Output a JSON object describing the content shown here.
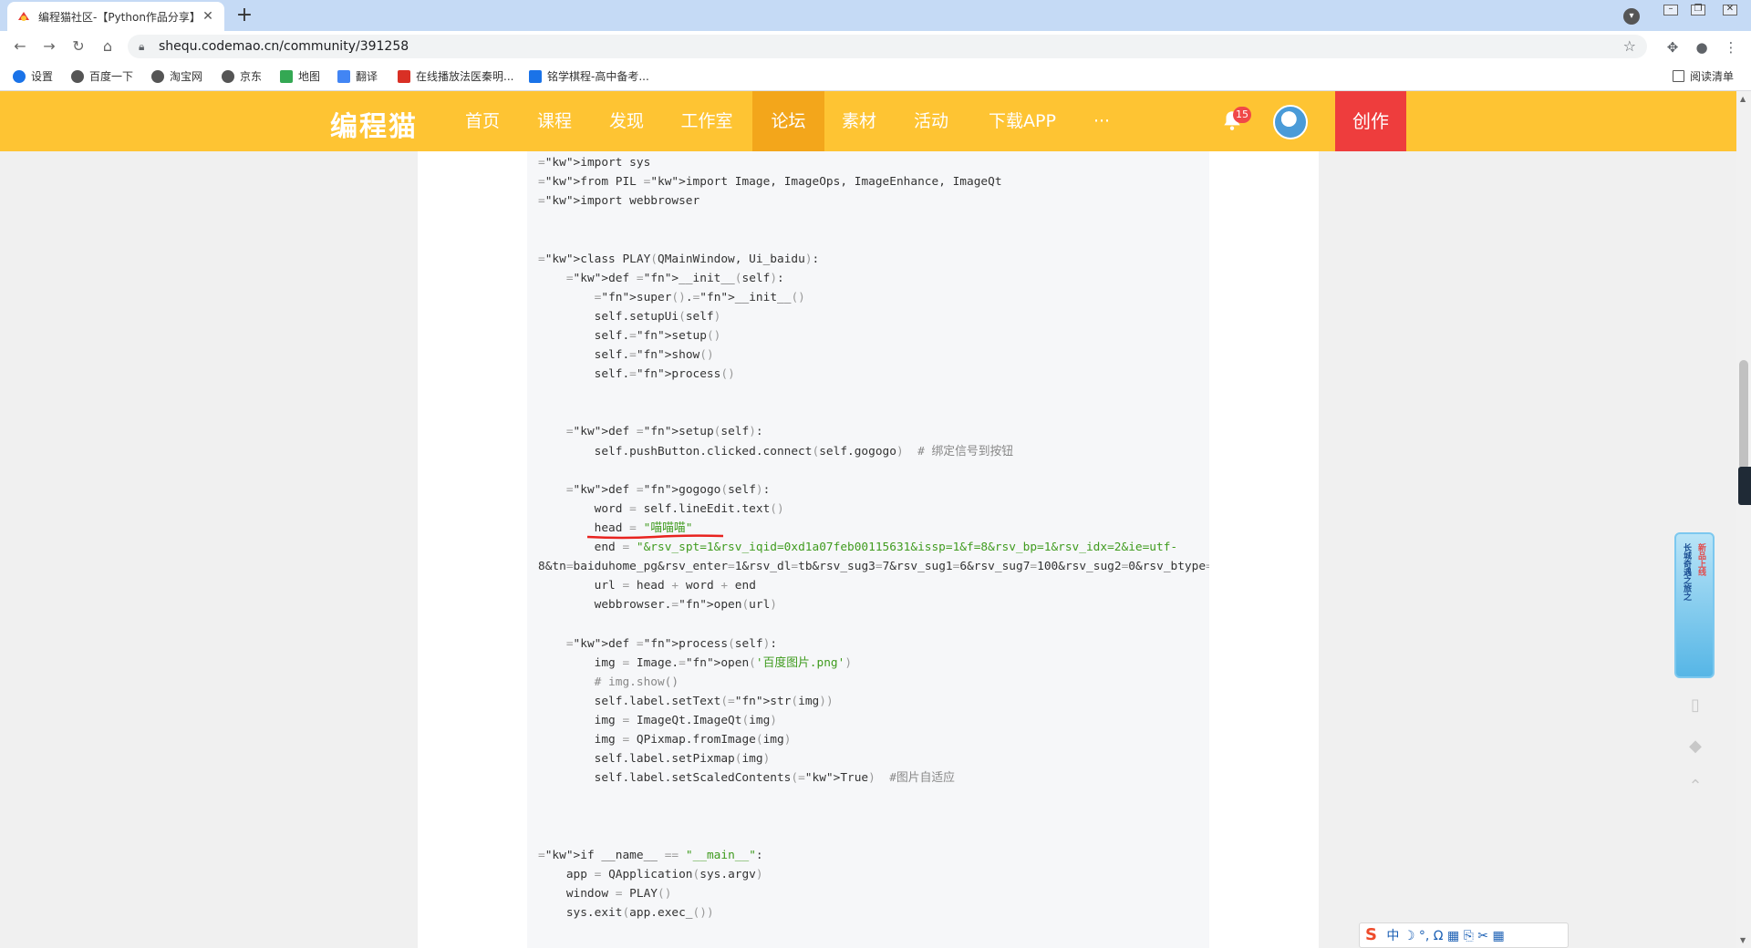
{
  "browser": {
    "tab_title": "编程猫社区-【Python作品分享】",
    "tab_close": "✕",
    "new_tab": "+",
    "url": "shequ.codemao.cn/community/391258",
    "bookmarks": [
      "设置",
      "百度一下",
      "淘宝网",
      "京东",
      "地图",
      "翻译",
      "在线播放法医秦明...",
      "铭学棋程-高中备考..."
    ],
    "reading_list": "阅读清单"
  },
  "site": {
    "logo": "编程猫",
    "nav": [
      "首页",
      "课程",
      "发现",
      "工作室",
      "论坛",
      "素材",
      "活动",
      "下载APP",
      "···"
    ],
    "active_nav": "论坛",
    "notification_count": "15",
    "create_label": "创作"
  },
  "code": {
    "lines": [
      {
        "t": "import sys"
      },
      {
        "t": "from PIL import Image, ImageOps, ImageEnhance, ImageQt"
      },
      {
        "t": "import webbrowser"
      },
      {
        "t": ""
      },
      {
        "t": ""
      },
      {
        "t": "class PLAY(QMainWindow, Ui_baidu):"
      },
      {
        "t": "    def __init__(self):"
      },
      {
        "t": "        super().__init__()"
      },
      {
        "t": "        self.setupUi(self)"
      },
      {
        "t": "        self.setup()"
      },
      {
        "t": "        self.show()"
      },
      {
        "t": "        self.process()"
      },
      {
        "t": ""
      },
      {
        "t": ""
      },
      {
        "t": "    def setup(self):"
      },
      {
        "t": "        self.pushButton.clicked.connect(self.gogogo)  # 绑定信号到按钮"
      },
      {
        "t": ""
      },
      {
        "t": "    def gogogo(self):"
      },
      {
        "t": "        word = self.lineEdit.text()"
      },
      {
        "t": "        head = \"喵喵喵\""
      },
      {
        "t": "        end = \"&rsv_spt=1&rsv_iqid=0xd1a07feb00115631&issp=1&f=8&rsv_bp=1&rsv_idx=2&ie=utf-"
      },
      {
        "t": "8&tn=baiduhome_pg&rsv_enter=1&rsv_dl=tb&rsv_sug3=7&rsv_sug1=6&rsv_sug7=100&rsv_sug2=0&rsv_btype="
      },
      {
        "t": "        url = head + word + end"
      },
      {
        "t": "        webbrowser.open(url)"
      },
      {
        "t": ""
      },
      {
        "t": "    def process(self):"
      },
      {
        "t": "        img = Image.open('百度图片.png')"
      },
      {
        "t": "        # img.show()"
      },
      {
        "t": "        self.label.setText(str(img))"
      },
      {
        "t": "        img = ImageQt.ImageQt(img)"
      },
      {
        "t": "        img = QPixmap.fromImage(img)"
      },
      {
        "t": "        self.label.setPixmap(img)"
      },
      {
        "t": "        self.label.setScaledContents(True)  #图片自适应"
      },
      {
        "t": ""
      },
      {
        "t": ""
      },
      {
        "t": ""
      },
      {
        "t": "if __name__ == \"__main__\":"
      },
      {
        "t": "    app = QApplication(sys.argv)"
      },
      {
        "t": "    window = PLAY()"
      },
      {
        "t": "    sys.exit(app.exec_())"
      }
    ]
  },
  "floating_banner": {
    "text_a": "长城奇遇之旅之",
    "text_b": "新品上线"
  },
  "ime": {
    "logo": "S",
    "items": [
      "中",
      "☽",
      "°,",
      "Ω",
      "▦",
      "⎘",
      "✂",
      "▦"
    ]
  },
  "colors": {
    "brand_yellow": "#fec433",
    "nav_active": "#f3a61b",
    "create_red": "#ee3d3d",
    "annotation_red": "#e8231f"
  }
}
